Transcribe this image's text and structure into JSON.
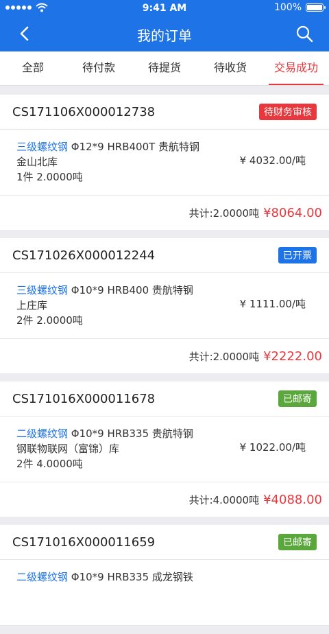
{
  "status": {
    "time": "9:41 AM",
    "battery": "100%"
  },
  "header": {
    "title": "我的订单"
  },
  "tabs": [
    {
      "label": "全部"
    },
    {
      "label": "待付款"
    },
    {
      "label": "待提货"
    },
    {
      "label": "待收货"
    },
    {
      "label": "交易成功"
    }
  ],
  "orders": [
    {
      "no": "CS171106X000012738",
      "badge": "待财务审核",
      "badge_color": "#e8383d",
      "grade": "三级螺纹钢",
      "spec": " Φ12*9  HRB400T 贵航特钢",
      "warehouse": "金山北库",
      "qty": "1件 2.0000吨",
      "unit_price": "¥ 4032.00/吨",
      "total_label": "共计:2.0000吨",
      "total": "¥8064.00"
    },
    {
      "no": "CS171026X000012244",
      "badge": "已开票",
      "badge_color": "#1e73e6",
      "grade": "三级螺纹钢",
      "spec": " Φ10*9  HRB400 贵航特钢",
      "warehouse": "上庄库",
      "qty": "2件 2.0000吨",
      "unit_price": "¥ 1111.00/吨",
      "total_label": "共计:2.0000吨",
      "total": "¥2222.00"
    },
    {
      "no": "CS171016X000011678",
      "badge": "已邮寄",
      "badge_color": "#5aa83c",
      "grade": "二级螺纹钢",
      "spec": " Φ10*9  HRB335 贵航特钢",
      "warehouse": "钢联物联网（富锦）库",
      "qty": "2件 4.0000吨",
      "unit_price": "¥ 1022.00/吨",
      "total_label": "共计:4.0000吨",
      "total": "¥4088.00"
    },
    {
      "no": "CS171016X000011659",
      "badge": "已邮寄",
      "badge_color": "#5aa83c",
      "grade": "二级螺纹钢",
      "spec": " Φ10*9  HRB335 成龙钢铁",
      "warehouse": "",
      "qty": "",
      "unit_price": "",
      "total_label": "",
      "total": ""
    }
  ]
}
